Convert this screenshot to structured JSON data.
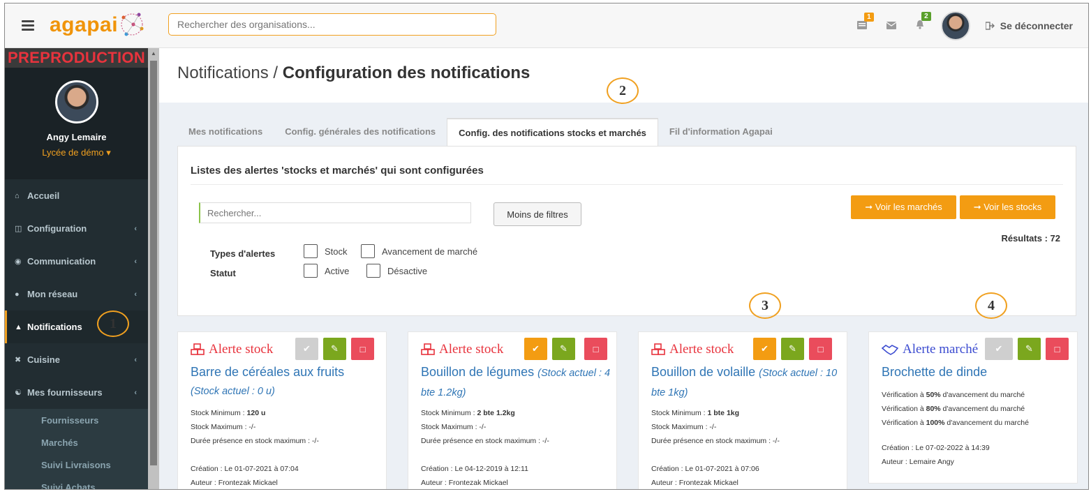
{
  "topbar": {
    "logo": "agapai",
    "search_placeholder": "Rechercher des organisations...",
    "tasks_badge": "1",
    "notif_badge": "2",
    "logout_label": "Se déconnecter"
  },
  "sidebar": {
    "env_label": "PREPRODUCTION",
    "user_name": "Angy Lemaire",
    "user_org": "Lycée de démo ▾",
    "items": [
      {
        "label": "Accueil",
        "icon": "home-icon",
        "chevron": ""
      },
      {
        "label": "Configuration",
        "icon": "bank-icon",
        "chevron": "‹"
      },
      {
        "label": "Communication",
        "icon": "comments-icon",
        "chevron": "‹"
      },
      {
        "label": "Mon réseau",
        "icon": "users-icon",
        "chevron": "‹"
      },
      {
        "label": "Notifications",
        "icon": "bell-icon",
        "chevron": ""
      },
      {
        "label": "Cuisine",
        "icon": "cutlery-icon",
        "chevron": "‹"
      },
      {
        "label": "Mes fournisseurs",
        "icon": "handshake-icon",
        "chevron": "‹"
      }
    ],
    "subitems": [
      "Fournisseurs",
      "Marchés",
      "Suivi Livraisons",
      "Suivi Achats"
    ]
  },
  "header": {
    "breadcrumb_root": "Notifications / ",
    "breadcrumb_current": "Configuration des notifications"
  },
  "tabs": [
    "Mes notifications",
    "Config. générales des notifications",
    "Config. des notifications stocks et marchés",
    "Fil d'information Agapai"
  ],
  "panel": {
    "title": "Listes des alertes 'stocks et marchés' qui sont configurées",
    "search_placeholder": "Rechercher...",
    "filters_button": "Moins de filtres",
    "btn_markets": "➞ Voir les marchés",
    "btn_stocks": "➞ Voir les stocks",
    "results": "Résultats : 72",
    "types_label": "Types d'alertes",
    "status_label": "Statut",
    "type_stock": "Stock",
    "type_market": "Avancement de marché",
    "status_active": "Active",
    "status_inactive": "Désactive"
  },
  "cards": [
    {
      "type": "Alerte stock",
      "name": "Barre de céréales aux fruits",
      "stock": "(Stock actuel : 0 u)",
      "min_label": "Stock Minimum : ",
      "min": "120 u",
      "max": "Stock Maximum : -/-",
      "duration": "Durée présence en stock maximum : -/-",
      "created": "Création : Le 01-07-2021 à 07:04",
      "author": "Auteur : Frontezak Mickael"
    },
    {
      "type": "Alerte stock",
      "name": "Bouillon de légumes",
      "stock": "(Stock actuel : 4 bte 1.2kg)",
      "min_label": "Stock Minimum : ",
      "min": "2 bte 1.2kg",
      "max": "Stock Maximum : -/-",
      "duration": "Durée présence en stock maximum : -/-",
      "created": "Création : Le 04-12-2019 à 12:11",
      "author": "Auteur : Frontezak Mickael"
    },
    {
      "type": "Alerte stock",
      "name": "Bouillon de volaille",
      "stock": "(Stock actuel : 10 bte 1kg)",
      "min_label": "Stock Minimum : ",
      "min": "1 bte 1kg",
      "max": "Stock Maximum : -/-",
      "duration": "Durée présence en stock maximum : -/-",
      "created": "Création : Le 01-07-2021 à 07:06",
      "author": "Auteur : Frontezak Mickael"
    },
    {
      "type": "Alerte marché",
      "name": "Brochette de dinde",
      "v_prefix": "Vérification à ",
      "v_suffix": " d'avancement du marché",
      "v1": "50%",
      "v2": "80%",
      "v3": "100%",
      "created": "Création : Le 07-02-2022 à 14:39",
      "author": "Auteur : Lemaire Angy"
    }
  ],
  "callouts": [
    "1",
    "2",
    "3",
    "4"
  ],
  "colors": {
    "brand_orange": "#f39c12",
    "sidebar_bg": "#222d32",
    "danger": "#ea4c5c",
    "success": "#7ba71e",
    "link_blue": "#2f75b5"
  }
}
